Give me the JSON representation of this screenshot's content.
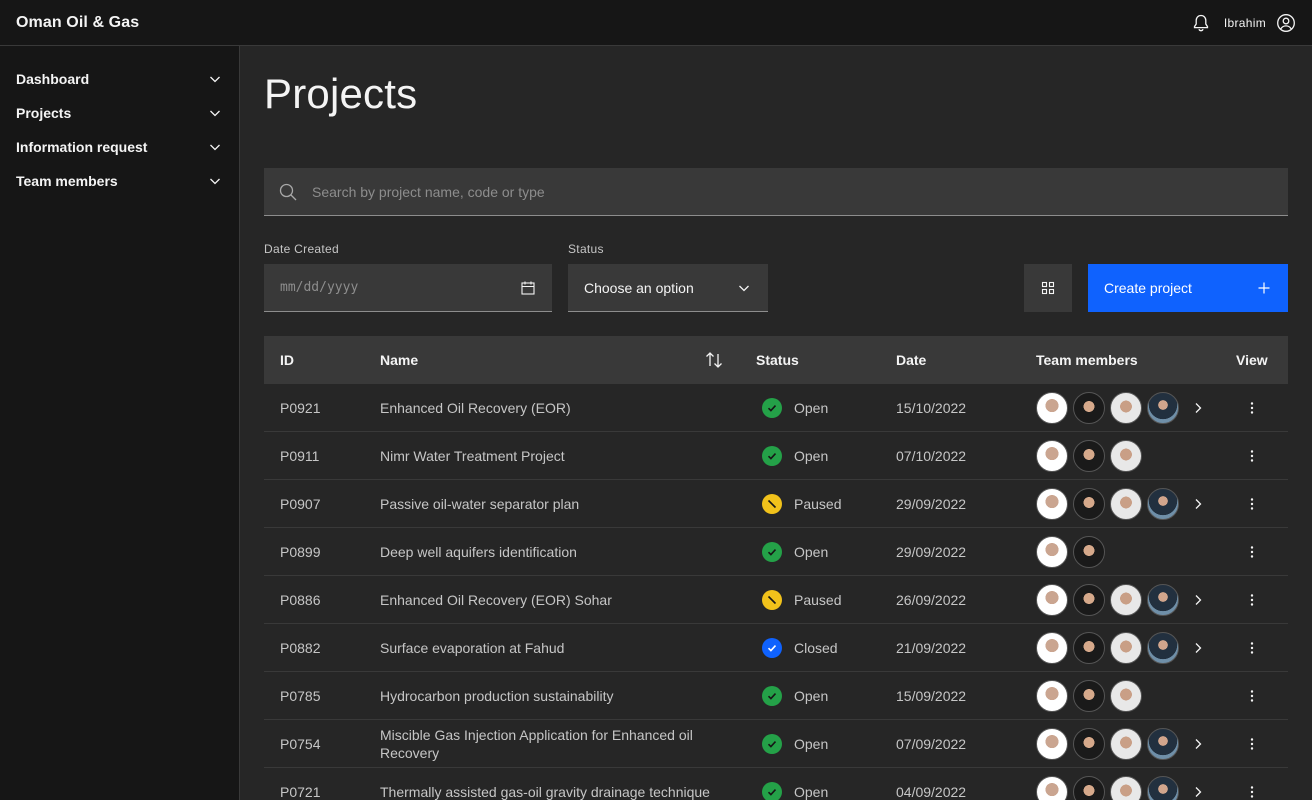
{
  "header": {
    "brand": "Oman Oil & Gas",
    "user_name": "Ibrahim"
  },
  "sidebar": {
    "items": [
      {
        "label": "Dashboard"
      },
      {
        "label": "Projects"
      },
      {
        "label": "Information request"
      },
      {
        "label": "Team members"
      }
    ]
  },
  "main": {
    "title": "Projects",
    "search": {
      "placeholder": "Search by project name, code or type"
    },
    "date_filter": {
      "label": "Date Created",
      "placeholder": "mm/dd/yyyy"
    },
    "status_filter": {
      "label": "Status",
      "value": "Choose an option"
    },
    "create_button": {
      "label": "Create project"
    }
  },
  "table": {
    "columns": {
      "id": "ID",
      "name": "Name",
      "status": "Status",
      "date": "Date",
      "team": "Team members",
      "view": "View"
    },
    "rows": [
      {
        "id": "P0921",
        "name": "Enhanced Oil Recovery (EOR)",
        "status": "Open",
        "date": "15/10/2022"
      },
      {
        "id": "P0911",
        "name": "Nimr Water Treatment Project",
        "status": "Open",
        "date": "07/10/2022"
      },
      {
        "id": "P0907",
        "name": "Passive oil-water separator plan",
        "status": "Paused",
        "date": "29/09/2022"
      },
      {
        "id": "P0899",
        "name": "Deep well aquifers identification",
        "status": "Open",
        "date": "29/09/2022"
      },
      {
        "id": "P0886",
        "name": "Enhanced Oil Recovery (EOR) Sohar",
        "status": "Paused",
        "date": "26/09/2022"
      },
      {
        "id": "P0882",
        "name": "Surface evaporation at Fahud",
        "status": "Closed",
        "date": "21/09/2022"
      },
      {
        "id": "P0785",
        "name": "Hydrocarbon production sustainability",
        "status": "Open",
        "date": "15/09/2022"
      },
      {
        "id": "P0754",
        "name": "Miscible Gas Injection Application for Enhanced oil Recovery",
        "status": "Open",
        "date": "07/09/2022"
      },
      {
        "id": "P0721",
        "name": "Thermally assisted gas-oil gravity drainage technique",
        "status": "Open",
        "date": "04/09/2022"
      }
    ]
  },
  "colors": {
    "primary": "#0f62fe",
    "open": "#24a148",
    "paused": "#f1c21b",
    "closed": "#0f62fe"
  }
}
